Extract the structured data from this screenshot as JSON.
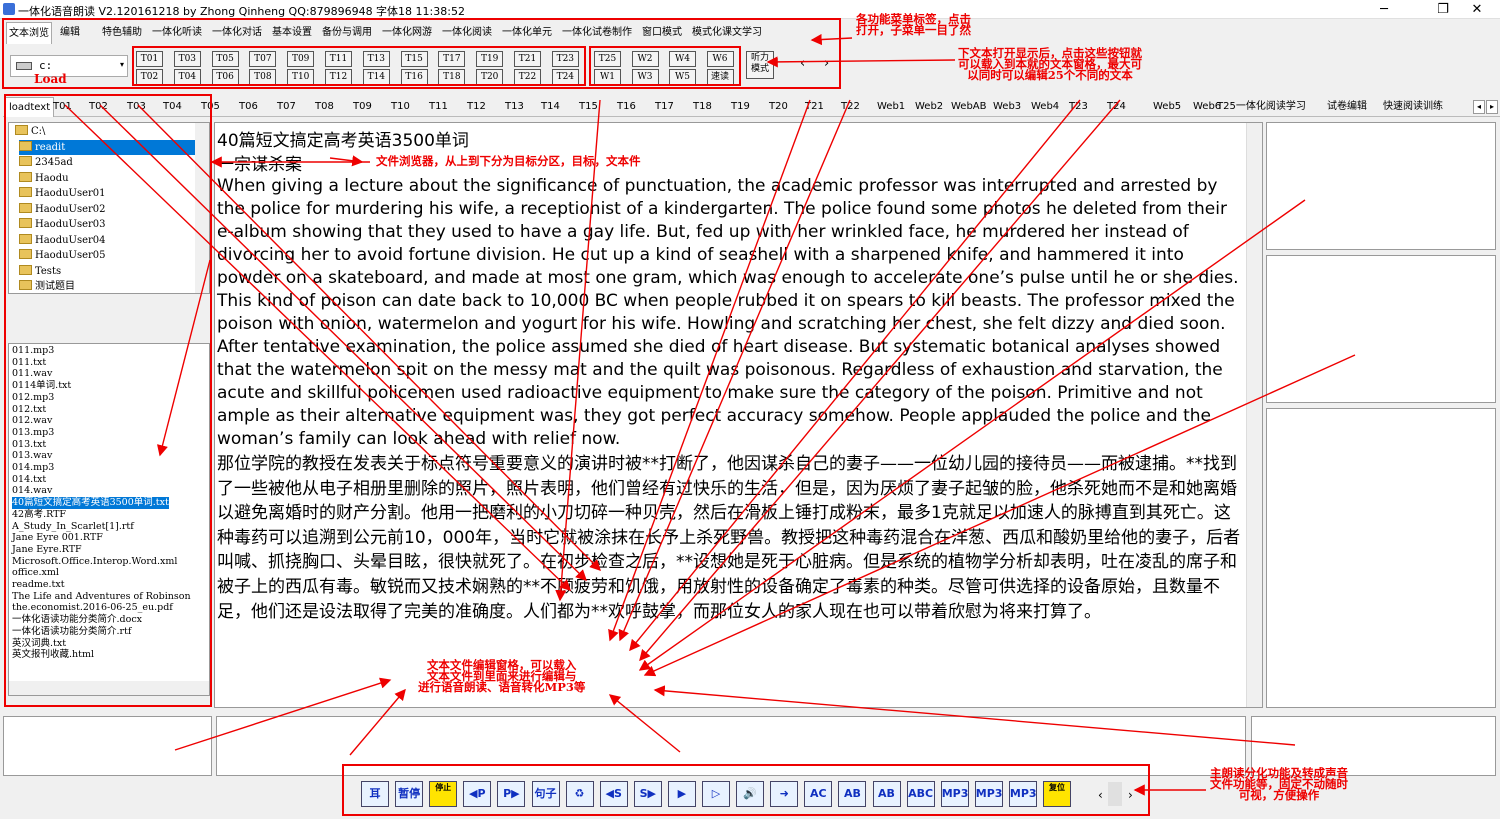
{
  "window": {
    "title": "一体化语音朗读 V2.120161218 by Zhong Qinheng QQ:879896948 字体18 11:38:52",
    "minimize": "─",
    "restore": "❐",
    "close": "✕"
  },
  "menu_tabs": [
    "文本浏览",
    "编辑",
    "特色辅助",
    "一体化听读",
    "一体化对话",
    "基本设置",
    "备份与调用",
    "一体化网游",
    "一体化阅读",
    "一体化单元",
    "一体化试卷制作",
    "窗口模式",
    "模式化课文学习"
  ],
  "drive": {
    "label": "c:",
    "load": "Load"
  },
  "text_buttons_top": [
    "T01",
    "T03",
    "T05",
    "T07",
    "T09",
    "T11",
    "T13",
    "T15",
    "T17",
    "T19",
    "T21",
    "T23"
  ],
  "text_buttons_bottom": [
    "T02",
    "T04",
    "T06",
    "T08",
    "T10",
    "T12",
    "T14",
    "T16",
    "T18",
    "T20",
    "T22",
    "T24"
  ],
  "extra_buttons_top": [
    "T25",
    "W2",
    "W4",
    "W6"
  ],
  "extra_buttons_bottom": [
    "W1",
    "W3",
    "W5",
    "速读"
  ],
  "listen_mode": "听力模式",
  "nav": {
    "prev": "‹",
    "next": "›"
  },
  "doc_tabs": [
    "loadtext",
    "T01",
    "T02",
    "T03",
    "T04",
    "T05",
    "T06",
    "T07",
    "T08",
    "T09",
    "T10",
    "T11",
    "T12",
    "T13",
    "T14",
    "T15",
    "T16",
    "T17",
    "T18",
    "T19",
    "T20",
    "T21",
    "T22",
    "Web1",
    "Web2",
    "WebAB",
    "Web3",
    "Web4",
    "T23",
    "T24",
    "Web5",
    "Web6",
    "T25一体化阅读学习",
    "试卷编辑",
    "快速阅读训练"
  ],
  "folders": [
    "C:\\",
    "readit",
    "2345ad",
    "Haodu",
    "HaoduUser01",
    "HaoduUser02",
    "HaoduUser03",
    "HaoduUser04",
    "HaoduUser05",
    "Tests",
    "测试题目"
  ],
  "files": [
    "011.mp3",
    "011.txt",
    "011.wav",
    "0114单词.txt",
    "012.mp3",
    "012.txt",
    "012.wav",
    "013.mp3",
    "013.txt",
    "013.wav",
    "014.mp3",
    "014.txt",
    "014.wav",
    "40篇短文搞定高考英语3500单词.txt",
    "42高考.RTF",
    "A_Study_In_Scarlet[1].rtf",
    "Jane Eyre 001.RTF",
    "Jane Eyre.RTF",
    "Microsoft.Office.Interop.Word.xml",
    "office.xml",
    "readme.txt",
    "The Life and Adventures of Robinson",
    "the.economist.2016-06-25_eu.pdf",
    "一体化语读功能分类简介.docx",
    "一体化语读功能分类简介.rtf",
    "英汉词典.txt",
    "英文报刊收藏.html"
  ],
  "editor": {
    "heading1": "40篇短文搞定高考英语3500单词",
    "heading2": "一宗谋杀案",
    "english": "When giving a lecture about the significance of punctuation, the academic professor was interrupted and arrested by the police for murdering his wife, a receptionist of a kindergarten. The police found some photos he deleted from their e-album showing that they used to have a gay life. But, fed up with her wrinkled face, he murdered her instead of divorcing her to avoid fortune division. He cut up a kind of seashell with a sharpened knife, and hammered it into powder on a skateboard, and made at most one gram, which was enough to accelerate one’s pulse until he or she dies. This kind of poison can date back to 10,000 BC when people rubbed it on spears to kill beasts. The professor mixed the poison with onion, watermelon and yogurt for his wife. Howling and scratching her chest, she felt dizzy and died soon. After tentative examination, the police assumed she died of heart disease. But systematic botanical analyses showed that the watermelon spit on the messy mat and the quilt was poisonous. Regardless of exhaustion and starvation, the acute and skillful policemen used radioactive equipment to make sure the category of the poison. Primitive and not ample as their alternative equipment was, they got perfect accuracy somehow.  People applauded the police and the woman’s family can look ahead with relief now.",
    "chinese": "那位学院的教授在发表关于标点符号重要意义的演讲时被**打断了，他因谋杀自己的妻子——一位幼儿园的接待员——而被逮捕。**找到了一些被他从电子相册里删除的照片，照片表明，他们曾经有过快乐的生活，但是，因为厌烦了妻子起皱的脸，他杀死她而不是和她离婚以避免离婚时的财产分割。他用一把磨利的小刀切碎一种贝壳，然后在滑板上锤打成粉末，最多1克就足以加速人的脉搏直到其死亡。这种毒药可以追溯到公元前10，000年，当时它就被涂抹在长予上杀死野兽。教授把这种毒药混合在洋葱、西瓜和酸奶里给他的妻子，后者叫喊、抓挠胸口、头晕目眩，很快就死了。在初步检查之后，**设想她是死于心脏病。但是系统的植物学分析却表明，吐在凌乱的席子和被子上的西瓜有毒。敏锐而又技术娴熟的**不顾疲劳和饥饿，用放射性的设备确定了毒素的种类。尽管可供选择的设备原始，且数量不足，他们还是设法取得了完美的准确度。人们都为**欢呼鼓掌，而那位女人的家人现在也可以带着欣慰为将来打算了。"
  },
  "play_buttons": [
    {
      "icon": "ear-icon",
      "label": "耳"
    },
    {
      "icon": "pause-icon",
      "label": "暂停"
    },
    {
      "icon": "stop-icon",
      "label": "停止"
    },
    {
      "icon": "prev-paragraph-icon",
      "label": "◀P"
    },
    {
      "icon": "next-paragraph-icon",
      "label": "P▶"
    },
    {
      "icon": "sentence-icon",
      "label": "句子"
    },
    {
      "icon": "recycle-icon",
      "label": "♻"
    },
    {
      "icon": "prev-sentence-icon",
      "label": "◀S"
    },
    {
      "icon": "next-sentence-icon",
      "label": "S▶"
    },
    {
      "icon": "play-icon",
      "label": "▶"
    },
    {
      "icon": "play-circle-icon",
      "label": "▷"
    },
    {
      "icon": "speaker-icon",
      "label": "🔊"
    },
    {
      "icon": "arrow-in-icon",
      "label": "➜"
    },
    {
      "icon": "abc-person-icon",
      "label": "AC"
    },
    {
      "icon": "abc-teach-icon",
      "label": "AB"
    },
    {
      "icon": "abc-read-icon",
      "label": "AB"
    },
    {
      "icon": "abc-speak-icon",
      "label": "ABC"
    },
    {
      "icon": "mp3-icon",
      "label": "MP3"
    },
    {
      "icon": "mp3-disc-icon",
      "label": "MP3"
    },
    {
      "icon": "mp3-convert-icon",
      "label": "MP3"
    },
    {
      "icon": "reset-icon",
      "label": "复位"
    }
  ],
  "annotations": {
    "menu": [
      "各功能菜单标签，点击",
      "打开，子菜单一目了然"
    ],
    "buttons": [
      "下文本打开显示后，点击这些按钮就",
      "可以载入到本就的文本窗格，最大可",
      "以同时可以编辑25个不同的文本"
    ],
    "browser": "文件浏览器，从上到下分为目标分区，目标，文本件",
    "editor": [
      "文本文件编辑窗格，可以载入",
      "文本文件到里面来进行编辑与",
      "进行语音朗读、语音转化MP3等"
    ],
    "playbar": [
      "主朗读分化功能及转成声音",
      "文件功能等，固定不动随时",
      "可视，方便操作"
    ]
  }
}
